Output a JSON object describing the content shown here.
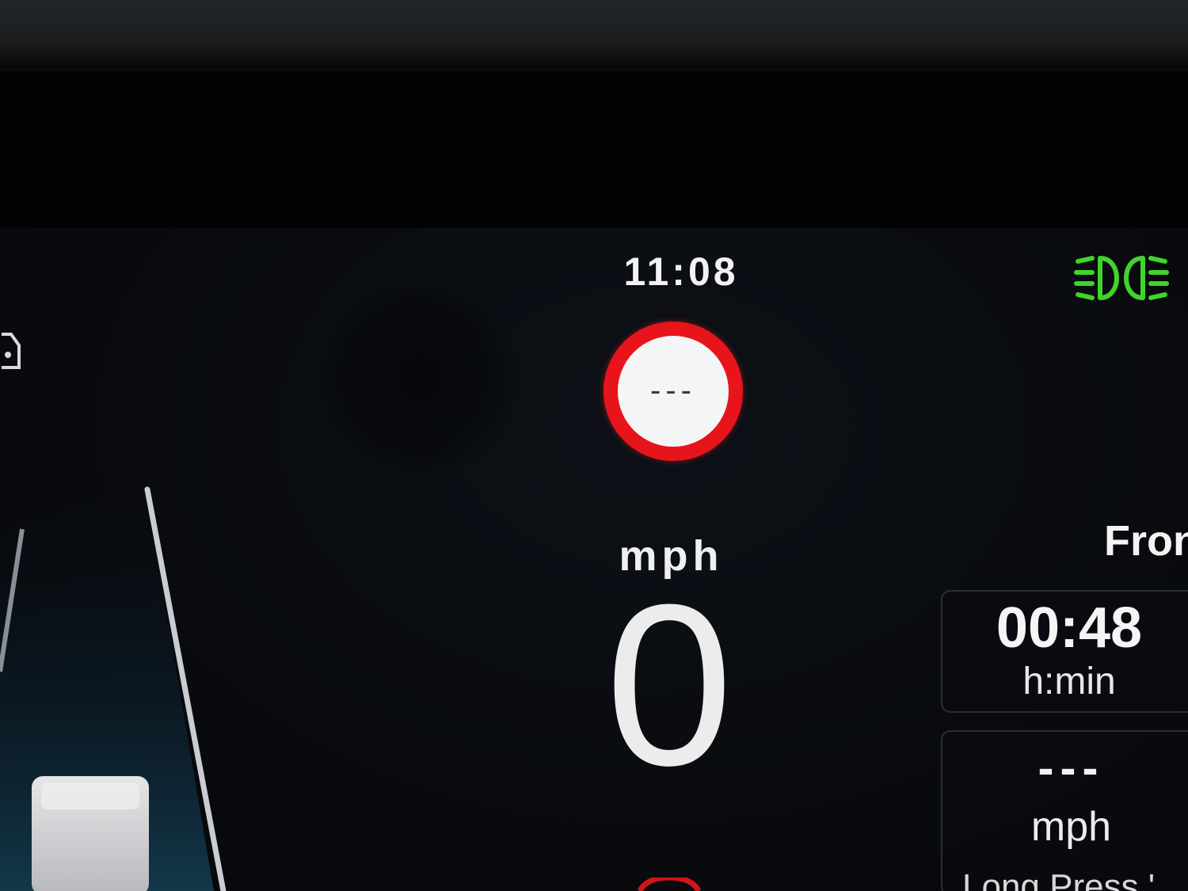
{
  "cluster": {
    "clock": "11:08",
    "speed_limit_sign": "---",
    "speed_unit": "mph",
    "speed_value": "0"
  },
  "indicators": {
    "headlight_icon": "headlight-icon",
    "headlight_color": "#3fd52a",
    "left_icon": "car-icon",
    "bottom_warning_color": "#d0141c"
  },
  "trip_panel": {
    "title": "Fron",
    "travel_time": "00:48",
    "travel_time_unit": "h:min",
    "avg_speed": "---",
    "avg_speed_unit": "mph",
    "hint": "Long Press '"
  },
  "colors": {
    "speed_sign_ring": "#e8141c",
    "speed_sign_face": "#f4f5f7",
    "screen_background": "#090b0f"
  }
}
